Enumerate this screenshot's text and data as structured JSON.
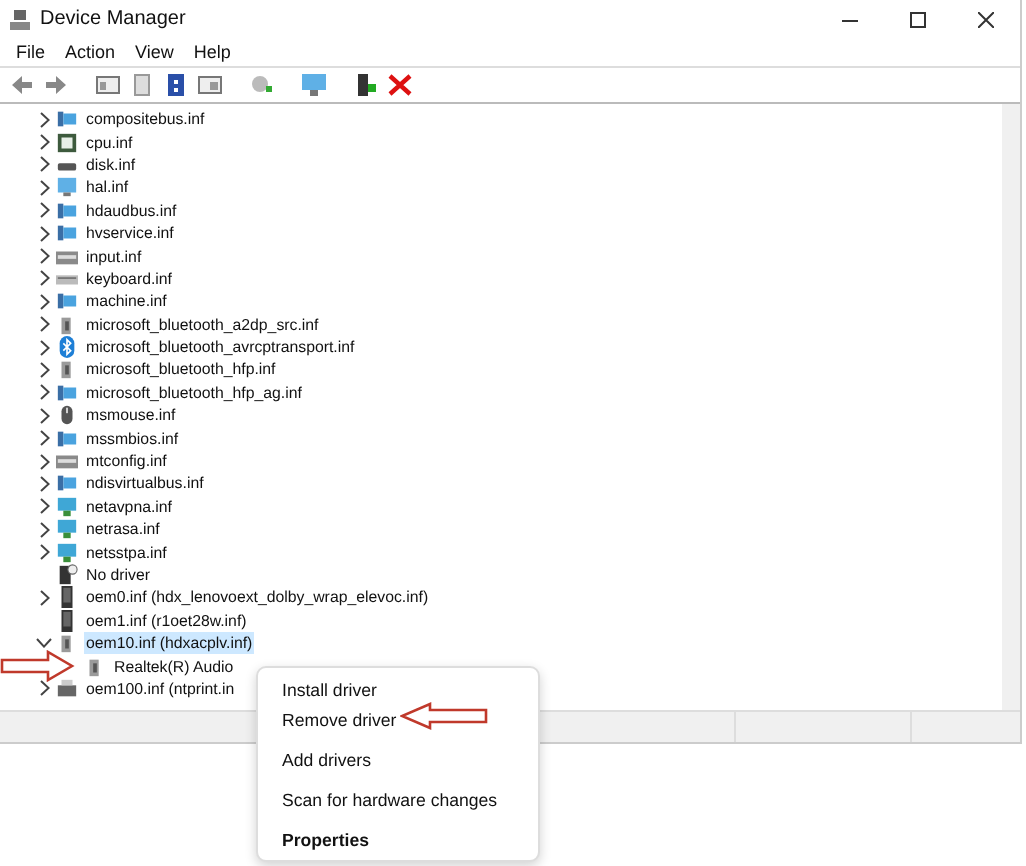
{
  "window": {
    "title": "Device Manager"
  },
  "menu": [
    "File",
    "Action",
    "View",
    "Help"
  ],
  "tree": {
    "items": [
      {
        "label": "compositebus.inf",
        "expandable": true,
        "expanded": false,
        "selected": false
      },
      {
        "label": "cpu.inf",
        "expandable": true,
        "expanded": false,
        "selected": false
      },
      {
        "label": "disk.inf",
        "expandable": true,
        "expanded": false,
        "selected": false
      },
      {
        "label": "hal.inf",
        "expandable": true,
        "expanded": false,
        "selected": false
      },
      {
        "label": "hdaudbus.inf",
        "expandable": true,
        "expanded": false,
        "selected": false
      },
      {
        "label": "hvservice.inf",
        "expandable": true,
        "expanded": false,
        "selected": false
      },
      {
        "label": "input.inf",
        "expandable": true,
        "expanded": false,
        "selected": false
      },
      {
        "label": "keyboard.inf",
        "expandable": true,
        "expanded": false,
        "selected": false
      },
      {
        "label": "machine.inf",
        "expandable": true,
        "expanded": false,
        "selected": false
      },
      {
        "label": "microsoft_bluetooth_a2dp_src.inf",
        "expandable": true,
        "expanded": false,
        "selected": false
      },
      {
        "label": "microsoft_bluetooth_avrcptransport.inf",
        "expandable": true,
        "expanded": false,
        "selected": false
      },
      {
        "label": "microsoft_bluetooth_hfp.inf",
        "expandable": true,
        "expanded": false,
        "selected": false
      },
      {
        "label": "microsoft_bluetooth_hfp_ag.inf",
        "expandable": true,
        "expanded": false,
        "selected": false
      },
      {
        "label": "msmouse.inf",
        "expandable": true,
        "expanded": false,
        "selected": false
      },
      {
        "label": "mssmbios.inf",
        "expandable": true,
        "expanded": false,
        "selected": false
      },
      {
        "label": "mtconfig.inf",
        "expandable": true,
        "expanded": false,
        "selected": false
      },
      {
        "label": "ndisvirtualbus.inf",
        "expandable": true,
        "expanded": false,
        "selected": false
      },
      {
        "label": "netavpna.inf",
        "expandable": true,
        "expanded": false,
        "selected": false
      },
      {
        "label": "netrasa.inf",
        "expandable": true,
        "expanded": false,
        "selected": false
      },
      {
        "label": "netsstpa.inf",
        "expandable": true,
        "expanded": false,
        "selected": false
      },
      {
        "label": "No driver",
        "expandable": false,
        "selected": false
      },
      {
        "label": "oem0.inf (hdx_lenovoext_dolby_wrap_elevoc.inf)",
        "expandable": true,
        "expanded": false,
        "selected": false
      },
      {
        "label": "oem1.inf (r1oet28w.inf)",
        "expandable": false,
        "selected": false
      },
      {
        "label": "oem10.inf (hdxacplv.inf)",
        "expandable": true,
        "expanded": true,
        "selected": true,
        "children": [
          {
            "label": "Realtek(R) Audio",
            "expandable": false,
            "selected": false
          }
        ]
      },
      {
        "label": "oem100.inf (ntprint.in",
        "expandable": true,
        "expanded": false,
        "selected": false
      }
    ]
  },
  "context_menu": {
    "groups": [
      [
        {
          "label": "Install driver",
          "default": false
        },
        {
          "label": "Remove driver",
          "default": false
        }
      ],
      [
        {
          "label": "Add drivers",
          "default": false
        }
      ],
      [
        {
          "label": "Scan for hardware changes",
          "default": false
        }
      ],
      [
        {
          "label": "Properties",
          "default": true
        }
      ]
    ]
  }
}
